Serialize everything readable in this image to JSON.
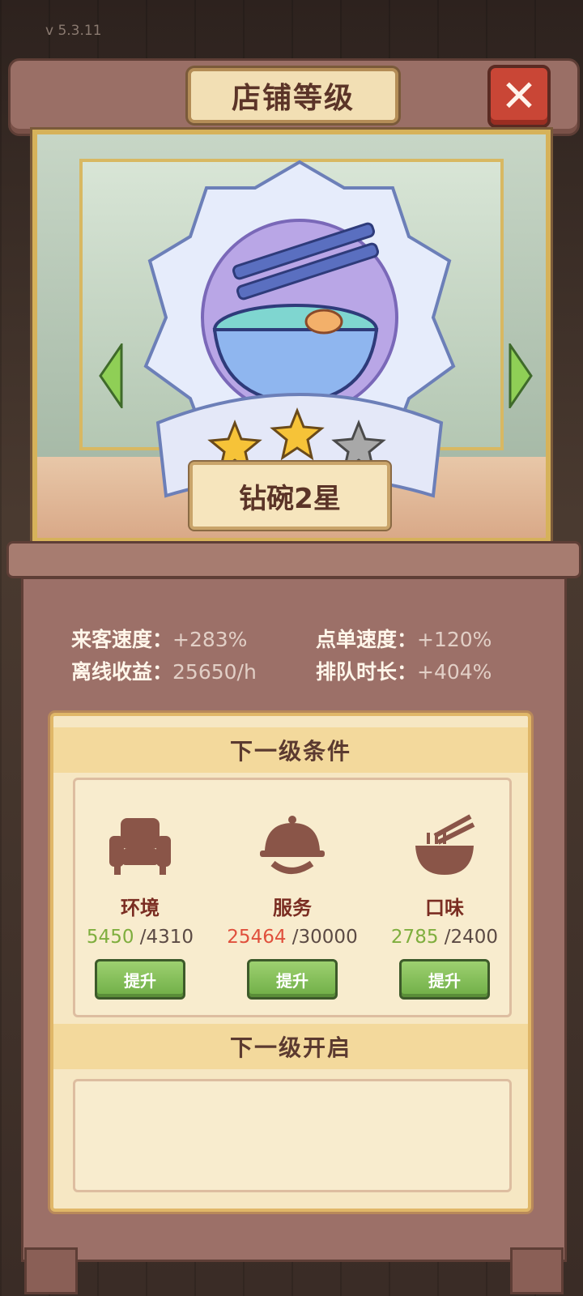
{
  "version": "v  5.3.11",
  "panel": {
    "title": "店铺等级",
    "close_label": "✕"
  },
  "badge": {
    "level_name": "钻碗2星",
    "stars_filled": 2,
    "stars_total": 3
  },
  "stats": {
    "guest_speed_label": "来客速度：",
    "guest_speed_value": "+283%",
    "order_speed_label": "点单速度：",
    "order_speed_value": "+120%",
    "offline_income_label": "离线收益：",
    "offline_income_value": "25650/h",
    "queue_time_label": "排队时长：",
    "queue_time_value": "+404%"
  },
  "conditions": {
    "title": "下一级条件",
    "items": [
      {
        "label": "环境",
        "current": "5450",
        "required": "/4310",
        "met": true,
        "icon": "armchair-icon",
        "button": "提升"
      },
      {
        "label": "服务",
        "current": "25464",
        "required": "/30000",
        "met": false,
        "icon": "serving-cloche-icon",
        "button": "提升"
      },
      {
        "label": "口味",
        "current": "2785",
        "required": "/2400",
        "met": true,
        "icon": "noodle-bowl-icon",
        "button": "提升"
      }
    ]
  },
  "unlock": {
    "title": "下一级开启"
  },
  "colors": {
    "met": "#7fae3e",
    "unmet": "#e0503c",
    "button_green": "#6fae46",
    "close_red": "#c94636"
  }
}
